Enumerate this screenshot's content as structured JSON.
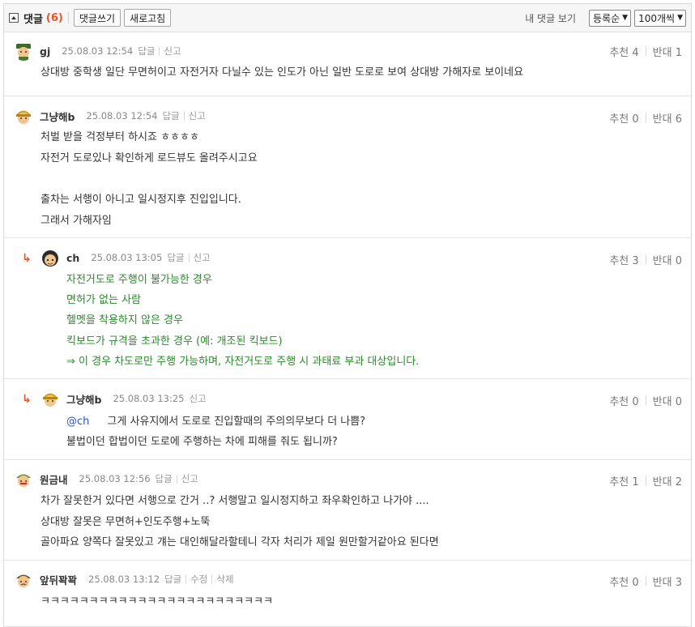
{
  "header": {
    "title": "댓글",
    "count": "(6)",
    "write_btn": "댓글쓰기",
    "refresh_btn": "새로고침",
    "my_comments": "내 댓글 보기",
    "sort_select": "등록순",
    "per_page_select": "100개씩"
  },
  "labels": {
    "reply": "답글",
    "report": "신고",
    "edit": "수정",
    "delete": "삭제",
    "upvote": "추천",
    "downvote": "반대"
  },
  "comments": [
    {
      "nick": "gj",
      "date": "25.08.03 12:54",
      "up": "4",
      "down": "1",
      "lines": [
        "상대방 중학생 일단 무면허이고 자전거자 다닐수 있는 인도가 아닌 일반 도로로 보여 상대방 가해자로 보이네요"
      ]
    },
    {
      "nick": "그냥해b",
      "date": "25.08.03 12:54",
      "up": "0",
      "down": "6",
      "lines": [
        "처벌 받을 걱정부터 하시죠 ㅎㅎㅎㅎ",
        "자전거 도로있나 확인하게 로드뷰도 올려주시고요",
        "",
        "출차는 서행이 아니고 일시정지후 진입입니다.",
        "그래서 가해자임"
      ]
    },
    {
      "nick": "ch",
      "date": "25.08.03 13:05",
      "up": "3",
      "down": "0",
      "lines": [
        "자전거도로 주행이 불가능한 경우",
        "면허가 없는 사람",
        "헬멧을 착용하지 않은 경우",
        "킥보드가 규격을 초과한 경우 (예: 개조된 킥보드)",
        "⇒ 이 경우 차도로만 주행 가능하며, 자전거도로 주행 시 과태료 부과 대상입니다."
      ]
    },
    {
      "nick": "그냥해b",
      "date": "25.08.03 13:25",
      "up": "0",
      "down": "0",
      "mention": "@ch",
      "lines": [
        "그게 사유지에서 도로로 진입할때의 주의의무보다 더 나쁨?",
        "불법이던 합법이던 도로에 주행하는 차에 피해를 줘도 됩니까?"
      ]
    },
    {
      "nick": "원금내",
      "date": "25.08.03 12:56",
      "up": "1",
      "down": "2",
      "lines": [
        "차가 잘못한거 있다면 서행으로 간거 ..? 서행말고 일시정지하고 좌우확인하고 나가야 ....",
        "상대방 잘못은 무면허+인도주행+노뚝",
        "골아파요 양쪽다 잘못있고 걔는 대인해달라할테니 각자 처리가 제일 원만할거같아요 된다면"
      ]
    },
    {
      "nick": "앞뒤꽉꽉",
      "date": "25.08.03 13:12",
      "up": "0",
      "down": "3",
      "lines": [
        "ㅋㅋㅋㅋㅋㅋㅋㅋㅋㅋㅋㅋㅋㅋㅋㅋㅋㅋㅋㅋㅋㅋㅋㅋ"
      ]
    }
  ],
  "colors": {
    "accent": "#e8542b",
    "green_text": "#2a8a2a",
    "mention": "#2a55c8"
  }
}
